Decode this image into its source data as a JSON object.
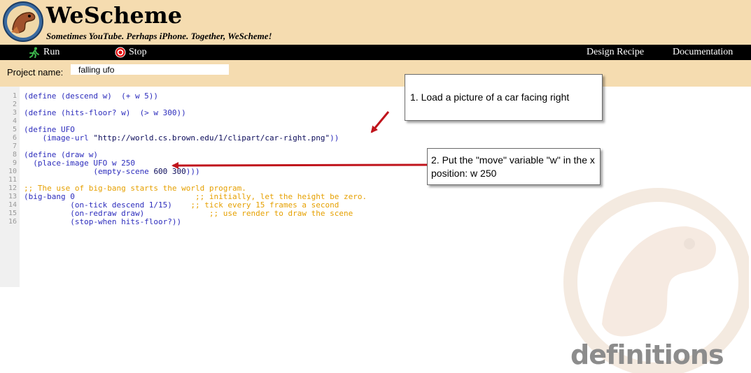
{
  "app": {
    "title": "WeScheme",
    "tagline": "Sometimes YouTube. Perhaps iPhone. Together, WeScheme!"
  },
  "toolbar": {
    "run_label": "Run",
    "stop_label": "Stop",
    "design_recipe_label": "Design Recipe",
    "documentation_label": "Documentation"
  },
  "project": {
    "label": "Project name:",
    "value": "falling ufo"
  },
  "editor": {
    "line_numbers": [
      "1",
      "2",
      "3",
      "4",
      "5",
      "6",
      "7",
      "8",
      "9",
      "10",
      "11",
      "12",
      "13",
      "14",
      "15",
      "16"
    ],
    "lines": [
      [
        {
          "t": "(define (descend w)  (+ w 5))",
          "c": "kw"
        }
      ],
      [],
      [
        {
          "t": "(define (hits-floor? w)  (> w 300))",
          "c": "kw"
        }
      ],
      [],
      [
        {
          "t": "(define UFO",
          "c": "kw"
        }
      ],
      [
        {
          "t": "    (image-url ",
          "c": "kw"
        },
        {
          "t": "\"http://world.cs.brown.edu/1/clipart/car-right.png\"",
          "c": "str"
        },
        {
          "t": "))",
          "c": "kw"
        }
      ],
      [],
      [
        {
          "t": "(define (draw w)",
          "c": "kw"
        }
      ],
      [
        {
          "t": "  (place-image UFO w 250",
          "c": "kw"
        }
      ],
      [
        {
          "t": "               (empty-scene ",
          "c": "kw"
        },
        {
          "t": "600 300",
          "c": "str"
        },
        {
          "t": ")))",
          "c": "kw"
        }
      ],
      [],
      [
        {
          "t": ";; The use of big-bang starts the world program.",
          "c": "cm"
        }
      ],
      [
        {
          "t": "(big-bang 0",
          "c": "kw"
        },
        {
          "t": "                          ;; initially, let the height be zero.",
          "c": "cm"
        }
      ],
      [
        {
          "t": "          (on-tick descend 1/15)",
          "c": "kw"
        },
        {
          "t": "    ;; tick every 15 frames a second",
          "c": "cm"
        }
      ],
      [
        {
          "t": "          (on-redraw draw)",
          "c": "kw"
        },
        {
          "t": "              ;; use render to draw the scene",
          "c": "cm"
        }
      ],
      [
        {
          "t": "          (stop-when hits-floor?))",
          "c": "kw"
        }
      ]
    ]
  },
  "watermark": {
    "text": "definitions"
  },
  "callouts": {
    "first": "1. Load a picture of a car facing right",
    "second": "2.  Put the \"move\" variable \"w\" in the x position:  w  250"
  },
  "colors": {
    "header_bg": "#f5dcb0",
    "toolbar_bg": "#000000",
    "keyword": "#2c2cbc",
    "comment": "#e6a000",
    "arrow": "#c0141c"
  }
}
